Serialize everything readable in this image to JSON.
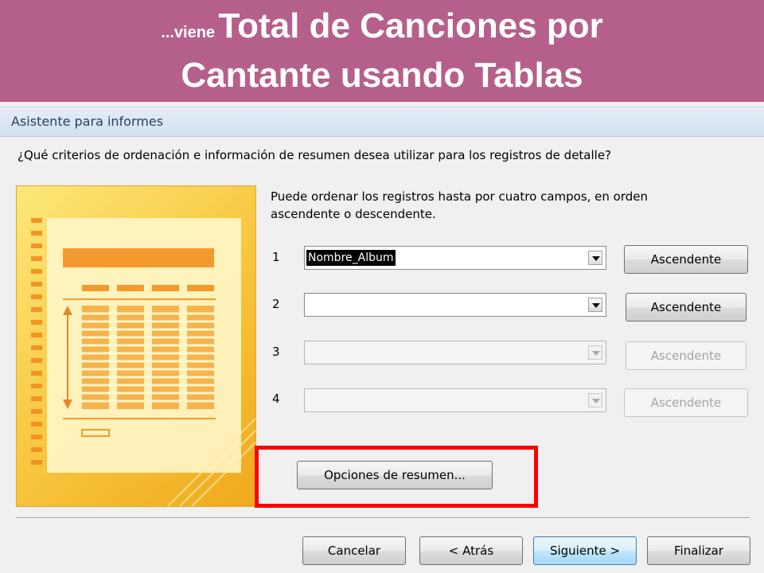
{
  "slide": {
    "title_prefix": "...viene",
    "title_line1": "Total de Canciones por",
    "title_line2": "Cantante usando Tablas",
    "banner_color": "#b5608a"
  },
  "dialog": {
    "title": "Asistente para informes",
    "question": "¿Qué criterios de ordenación e información de resumen desea utilizar para los registros de detalle?",
    "intro": "Puede ordenar los registros hasta por cuatro campos, en orden ascendente o descendente.",
    "sort_rows": [
      {
        "number": "1",
        "field": "Nombre_Album",
        "order_label": "Ascendente",
        "enabled": true
      },
      {
        "number": "2",
        "field": "",
        "order_label": "Ascendente",
        "enabled": true
      },
      {
        "number": "3",
        "field": "",
        "order_label": "Ascendente",
        "enabled": false
      },
      {
        "number": "4",
        "field": "",
        "order_label": "Ascendente",
        "enabled": false
      }
    ],
    "summary_options_label": "Opciones de resumen...",
    "highlight_color": "#ff0000",
    "buttons": {
      "cancel": "Cancelar",
      "back": "< Atrás",
      "next": "Siguiente >",
      "finish": "Finalizar"
    },
    "illustration_icon": "report-preview-icon"
  }
}
